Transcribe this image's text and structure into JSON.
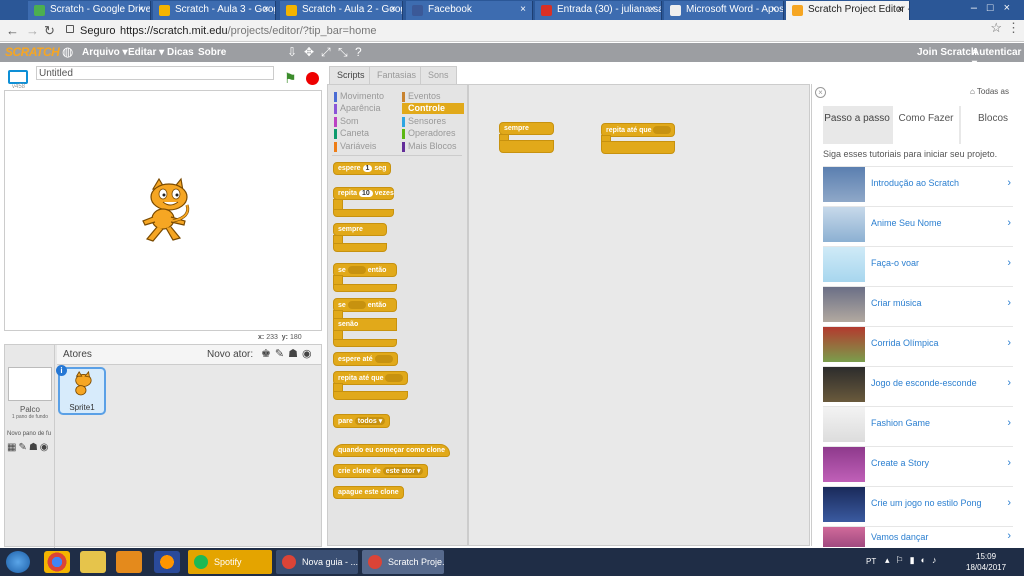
{
  "browser": {
    "tabs": [
      {
        "title": "Scratch - Google Drive",
        "active": false
      },
      {
        "title": "Scratch - Aula 3 - Googl",
        "active": false
      },
      {
        "title": "Scratch - Aula 2 - Googl",
        "active": false
      },
      {
        "title": "Facebook",
        "active": false
      },
      {
        "title": "Entrada (30) - juliana.sa",
        "active": false
      },
      {
        "title": "Microsoft Word - Apost",
        "active": false
      },
      {
        "title": "Scratch Project Editor -",
        "active": true
      }
    ],
    "secure_label": "Seguro",
    "url_main": "https://scratch.mit.edu",
    "url_path": "/projects/editor/?tip_bar=home",
    "close_glyph": "×"
  },
  "scratch": {
    "logo": "SCRATCH",
    "menu": {
      "file": "Arquivo ▾",
      "edit": "Editar ▾",
      "tips": "Dicas",
      "about": "Sobre"
    },
    "join": "Join Scratch",
    "signin": "Autenticar ▾",
    "project_title": "Untitled",
    "version": "v458",
    "coords_x_label": "x:",
    "coords_x": "233",
    "coords_y_label": "y:",
    "coords_y": "180",
    "sprites_header": "Atores",
    "new_sprite": "Novo ator:",
    "stage_label": "Palco",
    "stage_sub": "1 pano de fundo",
    "new_backdrop": "Novo pano de fu",
    "sprite_name": "Sprite1",
    "info": "i",
    "palette_tabs": [
      "Scripts",
      "Fantasias",
      "Sons"
    ],
    "categories_left": [
      {
        "name": "Movimento",
        "color": "#4a6cd4"
      },
      {
        "name": "Aparência",
        "color": "#8a55d7"
      },
      {
        "name": "Som",
        "color": "#bb42c3"
      },
      {
        "name": "Caneta",
        "color": "#0e9a6c"
      },
      {
        "name": "Variáveis",
        "color": "#ee7d16"
      }
    ],
    "categories_right": [
      {
        "name": "Eventos",
        "color": "#c88330"
      },
      {
        "name": "Controle",
        "color": "#e1a91a"
      },
      {
        "name": "Sensores",
        "color": "#2ca5e2"
      },
      {
        "name": "Operadores",
        "color": "#5cb712"
      },
      {
        "name": "Mais Blocos",
        "color": "#632d99"
      }
    ],
    "blocks": {
      "wait": "espere",
      "wait_val": "1",
      "wait_unit": "seg",
      "repeat": "repita",
      "repeat_val": "10",
      "repeat_unit": "vezes",
      "forever": "sempre",
      "if": "se",
      "then": "então",
      "if2": "se",
      "then2": "então",
      "else": "senão",
      "wait_until": "espere até",
      "repeat_until": "repita até que",
      "stop": "pare",
      "stop_opt": "todos ▾",
      "when_clone": "quando eu começar como clone",
      "create_clone": "crie clone de",
      "create_clone_opt": "este ator ▾",
      "delete_clone": "apague este clone"
    },
    "script_blocks": {
      "forever": "sempre",
      "repeat_until": "repita até que"
    },
    "accent": "#e1a91a"
  },
  "tips": {
    "all": "Todas as",
    "tabs": [
      "Passo a passo",
      "Como Fazer",
      "Blocos"
    ],
    "intro": "Siga esses tutoriais para iniciar seu projeto.",
    "tutorials": [
      "Introdução ao Scratch",
      "Anime Seu Nome",
      "Faça-o voar",
      "Criar música",
      "Corrida Olímpica",
      "Jogo de esconde-esconde",
      "Fashion Game",
      "Create a Story",
      "Crie um jogo no estilo Pong",
      "Vamos dançar"
    ],
    "chevron": "›"
  },
  "taskbar": {
    "tasks": [
      "Spotify",
      "Nova guia - ...",
      "Scratch Proje..."
    ],
    "lang": "PT",
    "time": "15:09",
    "date": "18/04/2017"
  }
}
